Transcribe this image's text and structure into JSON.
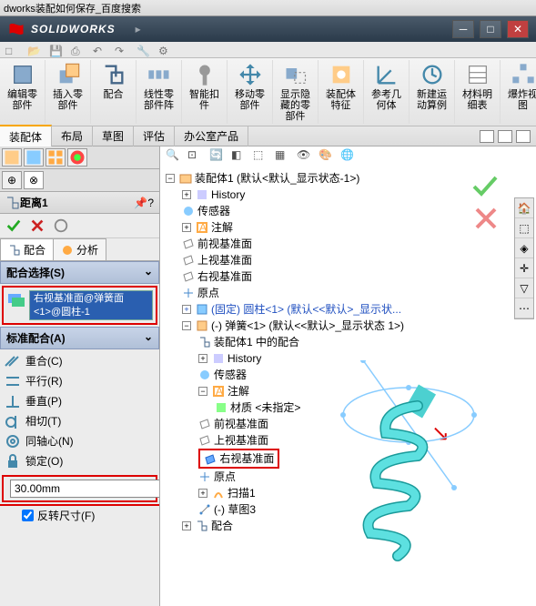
{
  "window": {
    "title": "dworks装配如何保存_百度搜索"
  },
  "brand": {
    "text": "SOLIDWORKS"
  },
  "ribbon": {
    "items": [
      {
        "label": "编辑零\n部件"
      },
      {
        "label": "插入零\n部件"
      },
      {
        "label": "配合"
      },
      {
        "label": "线性零\n部件阵"
      },
      {
        "label": "智能扣\n件"
      },
      {
        "label": "移动零\n部件"
      },
      {
        "label": "显示隐\n藏的零\n部件"
      },
      {
        "label": "装配体\n特征"
      },
      {
        "label": "参考几\n何体"
      },
      {
        "label": "新建运\n动算例"
      },
      {
        "label": "材料明\n细表"
      },
      {
        "label": "爆炸视\n图"
      }
    ]
  },
  "tabs": {
    "items": [
      {
        "label": "装配体",
        "active": true
      },
      {
        "label": "布局"
      },
      {
        "label": "草图"
      },
      {
        "label": "评估"
      },
      {
        "label": "办公室产品"
      }
    ]
  },
  "prop": {
    "title": "距离1",
    "subtabs": {
      "mate": "配合",
      "analyze": "分析"
    },
    "selection_header": "配合选择(S)",
    "selection_item": "右视基准面@弹簧面<1>@圆柱-1",
    "standard_header": "标准配合(A)",
    "mates": {
      "coincident": "重合(C)",
      "parallel": "平行(R)",
      "perpendicular": "垂直(P)",
      "tangent": "相切(T)",
      "concentric": "同轴心(N)",
      "lock": "锁定(O)"
    },
    "distance_value": "30.00mm",
    "flip_dim": "反转尺寸(F)"
  },
  "tree": {
    "root": "装配体1 (默认<默认_显示状态-1>)",
    "history": "History",
    "sensors": "传感器",
    "annotations": "注解",
    "front": "前视基准面",
    "top": "上视基准面",
    "right": "右视基准面",
    "origin": "原点",
    "fixed_cyl": "(固定) 圆柱<1> (默认<<默认>_显示状...",
    "spring": "(-) 弹簧<1> (默认<<默认>_显示状态 1>)",
    "spring_mates": "装配体1 中的配合",
    "spring_history": "History",
    "spring_sensors": "传感器",
    "spring_annotations": "注解",
    "material": "材质 <未指定>",
    "spring_front": "前视基准面",
    "spring_top": "上视基准面",
    "spring_right": "右视基准面",
    "spring_origin": "原点",
    "sweep": "扫描1",
    "sketch": "(-) 草图3",
    "mates_folder": "配合"
  }
}
